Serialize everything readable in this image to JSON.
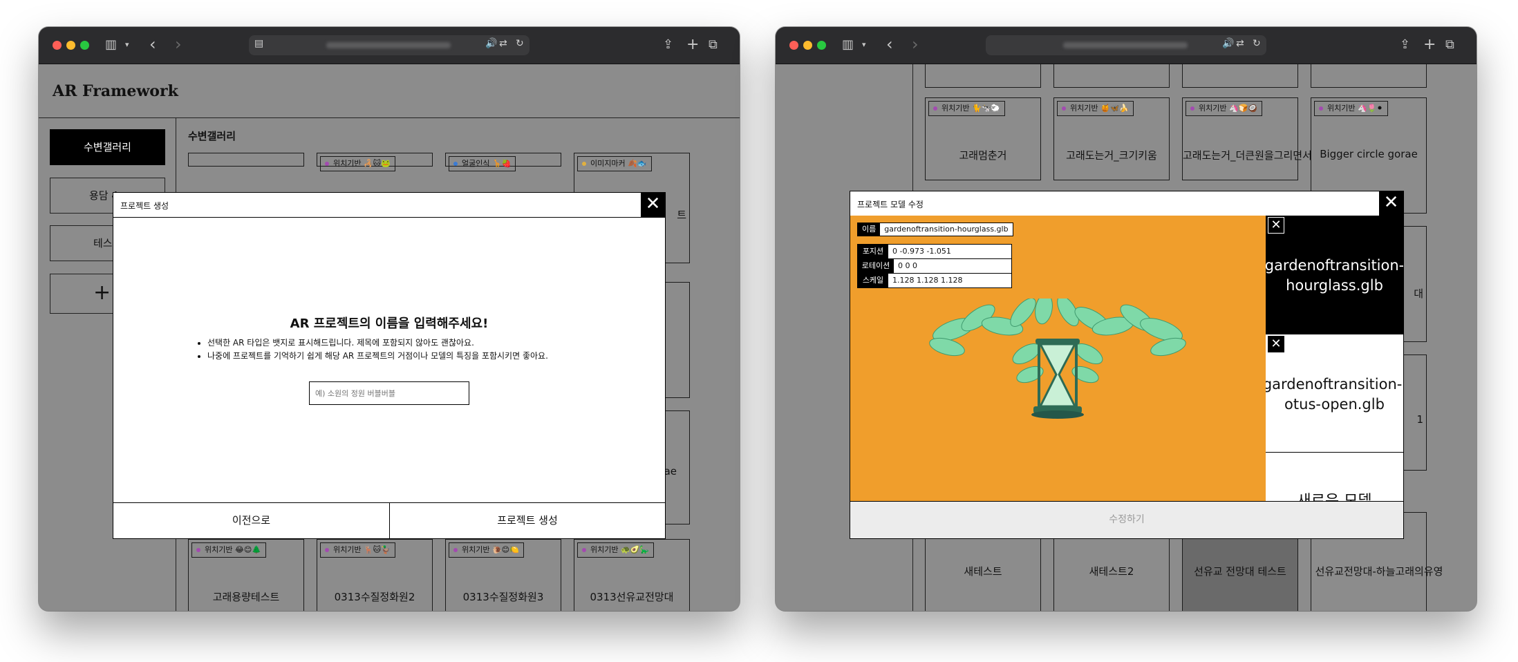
{
  "left": {
    "app_title": "AR Framework",
    "sidebar": [
      {
        "label": "수변갤러리"
      },
      {
        "label": "용담 4"
      },
      {
        "label": "테스"
      },
      {
        "label": "+"
      }
    ],
    "section_title": "수변갤러리",
    "top_tags": [
      {
        "tag": "위치기반 🦂🐱🐸"
      },
      {
        "tag": "얼굴인식 🦒🍓"
      },
      {
        "tag": "이미지마커 🍂🐟"
      }
    ],
    "bottom_cards": [
      {
        "tag": "위치기반 😂😊🌲",
        "title": "고래용량테스트"
      },
      {
        "tag": "위치기반 🦌🐱🦆",
        "title": "0313수질정화원2"
      },
      {
        "tag": "위치기반 🐌😊🍋",
        "title": "0313수질정화원3"
      },
      {
        "tag": "위치기반 🐢🥑🦕",
        "title": "0313선유교전망대"
      }
    ],
    "right_peek": [
      "트",
      "ae"
    ],
    "modal": {
      "title": "프로젝트 생성",
      "heading": "AR 프로젝트의 이름을 입력해주세요!",
      "bullets": [
        "선택한 AR 타입은 뱃지로 표시해드립니다. 제목에 포함되지 않아도 괜찮아요.",
        "나중에 프로젝트를 기억하기 쉽게 해당 AR 프로젝트의 거점이나 모델의 특징을 포함시키면 좋아요."
      ],
      "input_placeholder": "예) 소원의 정원 버블버블",
      "prev_label": "이전으로",
      "create_label": "프로젝트 생성"
    }
  },
  "right": {
    "top_cards": [
      {
        "tag": "위치기반 🐈🐄🐑",
        "title": "고래멈춘거"
      },
      {
        "tag": "위치기반 🍯🦋🍌",
        "title": "고래도는거_크기키움"
      },
      {
        "tag": "위치기반 🦄🍞🥥",
        "title": "고래도는거_더큰원을그리면서"
      },
      {
        "tag": "위치기반 🦄🌷⚫",
        "title": "Bigger circle gorae"
      }
    ],
    "bottom_cards": [
      {
        "title": "새테스트"
      },
      {
        "title": "새테스트2"
      },
      {
        "title": "선유교 전망대 테스트"
      },
      {
        "title": "선유교전망대-하늘고래의유영"
      }
    ],
    "peek": [
      "대",
      "1"
    ],
    "modal": {
      "title": "프로젝트 모델 수정",
      "name_label": "이름",
      "name_value": "gardenoftransition-hourglass.glb",
      "fields": [
        {
          "label": "포지션",
          "value": "0 -0.973 -1.051"
        },
        {
          "label": "로테이션",
          "value": "0 0 0"
        },
        {
          "label": "스케일",
          "value": "1.128 1.128 1.128"
        }
      ],
      "models": [
        {
          "name": "gardenoftransition-hourglass.glb"
        },
        {
          "name": "gardenoftransition-lotus-open.glb"
        }
      ],
      "new_model_label": "새로운 모델",
      "submit_label": "수정하기",
      "preview_bg": "#f09e2c"
    }
  }
}
